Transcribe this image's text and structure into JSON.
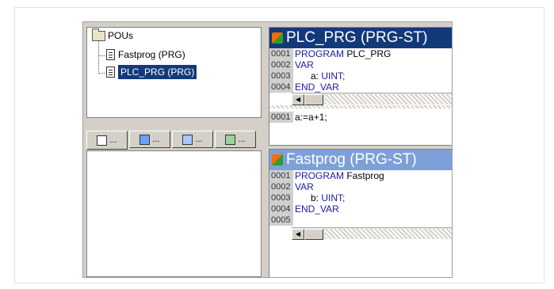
{
  "tree": {
    "root": "POUs",
    "items": [
      "Fastprog (PRG)",
      "PLC_PRG (PRG)"
    ]
  },
  "tabs": [
    "...",
    "...",
    "...",
    "..."
  ],
  "editor_top": {
    "title": "PLC_PRG (PRG-ST)",
    "lines": [
      {
        "num": "0001",
        "kw": "PROGRAM",
        "rest": " PLC_PRG"
      },
      {
        "num": "0002",
        "kw": "VAR",
        "rest": ""
      },
      {
        "num": "0003",
        "kw": "",
        "rest": "      a: ",
        "type": "UINT;"
      },
      {
        "num": "0004",
        "kw": "END_VAR",
        "rest": ""
      }
    ],
    "body_line": {
      "num": "0001",
      "text": "a:=a+1;"
    }
  },
  "editor_bottom": {
    "title": "Fastprog (PRG-ST)",
    "lines": [
      {
        "num": "0001",
        "kw": "PROGRAM",
        "rest": " Fastprog"
      },
      {
        "num": "0002",
        "kw": "VAR",
        "rest": ""
      },
      {
        "num": "0003",
        "kw": "",
        "rest": "      b: ",
        "type": "UINT;"
      },
      {
        "num": "0004",
        "kw": "END_VAR",
        "rest": ""
      },
      {
        "num": "0005",
        "kw": "",
        "rest": ""
      }
    ]
  },
  "colors": {
    "title_active": "#123a7a",
    "keyword": "#1a1aa0",
    "selection": "#123a7a"
  }
}
